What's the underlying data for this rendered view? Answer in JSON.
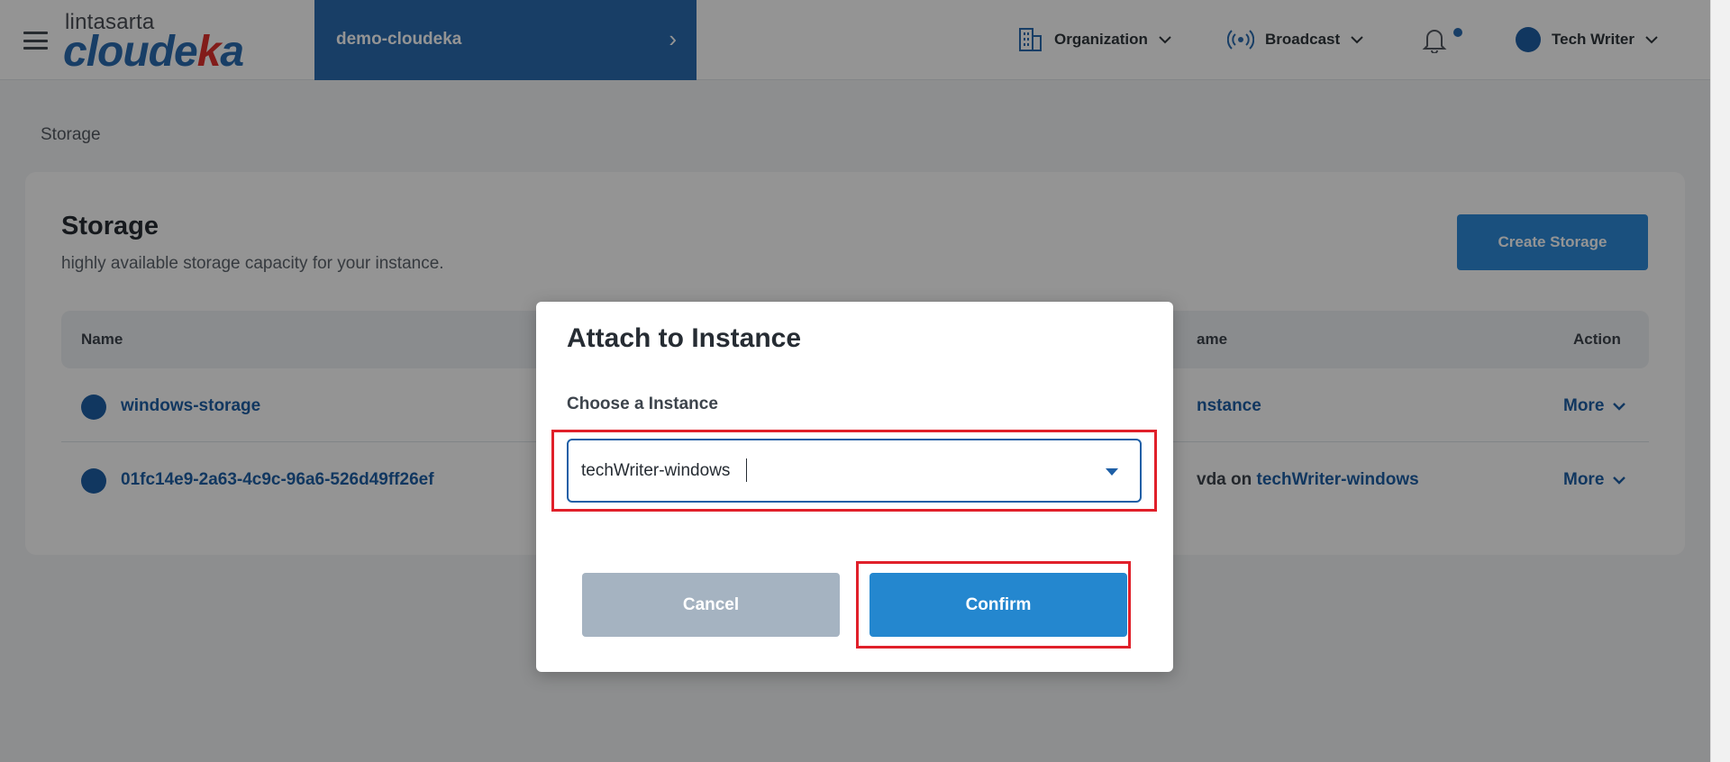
{
  "header": {
    "logo_top": "lintasarta",
    "logo_main_a": "cloude",
    "logo_main_accent": "k",
    "logo_main_b": "a",
    "project": "demo-cloudeka",
    "project_chevron": "›",
    "organization": "Organization",
    "broadcast": "Broadcast",
    "user": "Tech Writer",
    "caret": "⌄"
  },
  "breadcrumb": "Storage",
  "storage": {
    "title": "Storage",
    "subtitle": "highly available storage capacity for your instance.",
    "create_button": "Create Storage",
    "columns": {
      "name": "Name",
      "instance_fragment": "ame",
      "action": "Action"
    },
    "rows": [
      {
        "name": "windows-storage",
        "instance_plain": "",
        "instance_link": "nstance",
        "more": "More"
      },
      {
        "name": "01fc14e9-2a63-4c9c-96a6-526d49ff26ef",
        "instance_plain": "vda on ",
        "instance_link": "techWriter-windows",
        "more": "More"
      }
    ]
  },
  "modal": {
    "title": "Attach to Instance",
    "label": "Choose a Instance",
    "selected_value": "techWriter-windows",
    "cancel": "Cancel",
    "confirm": "Confirm"
  },
  "colors": {
    "brand_blue": "#2a6cb0",
    "link_blue": "#1e5fa6",
    "button_blue": "#2487cf",
    "cancel_gray": "#a5b3c1",
    "highlight_red": "#e0202a",
    "logo_accent_red": "#e0312d"
  },
  "icons": {
    "menu": "hamburger-menu-icon",
    "organization": "building-icon",
    "broadcast": "broadcast-icon",
    "notification": "bell-icon",
    "user": "avatar",
    "dropdown": "chevron-down-icon"
  }
}
